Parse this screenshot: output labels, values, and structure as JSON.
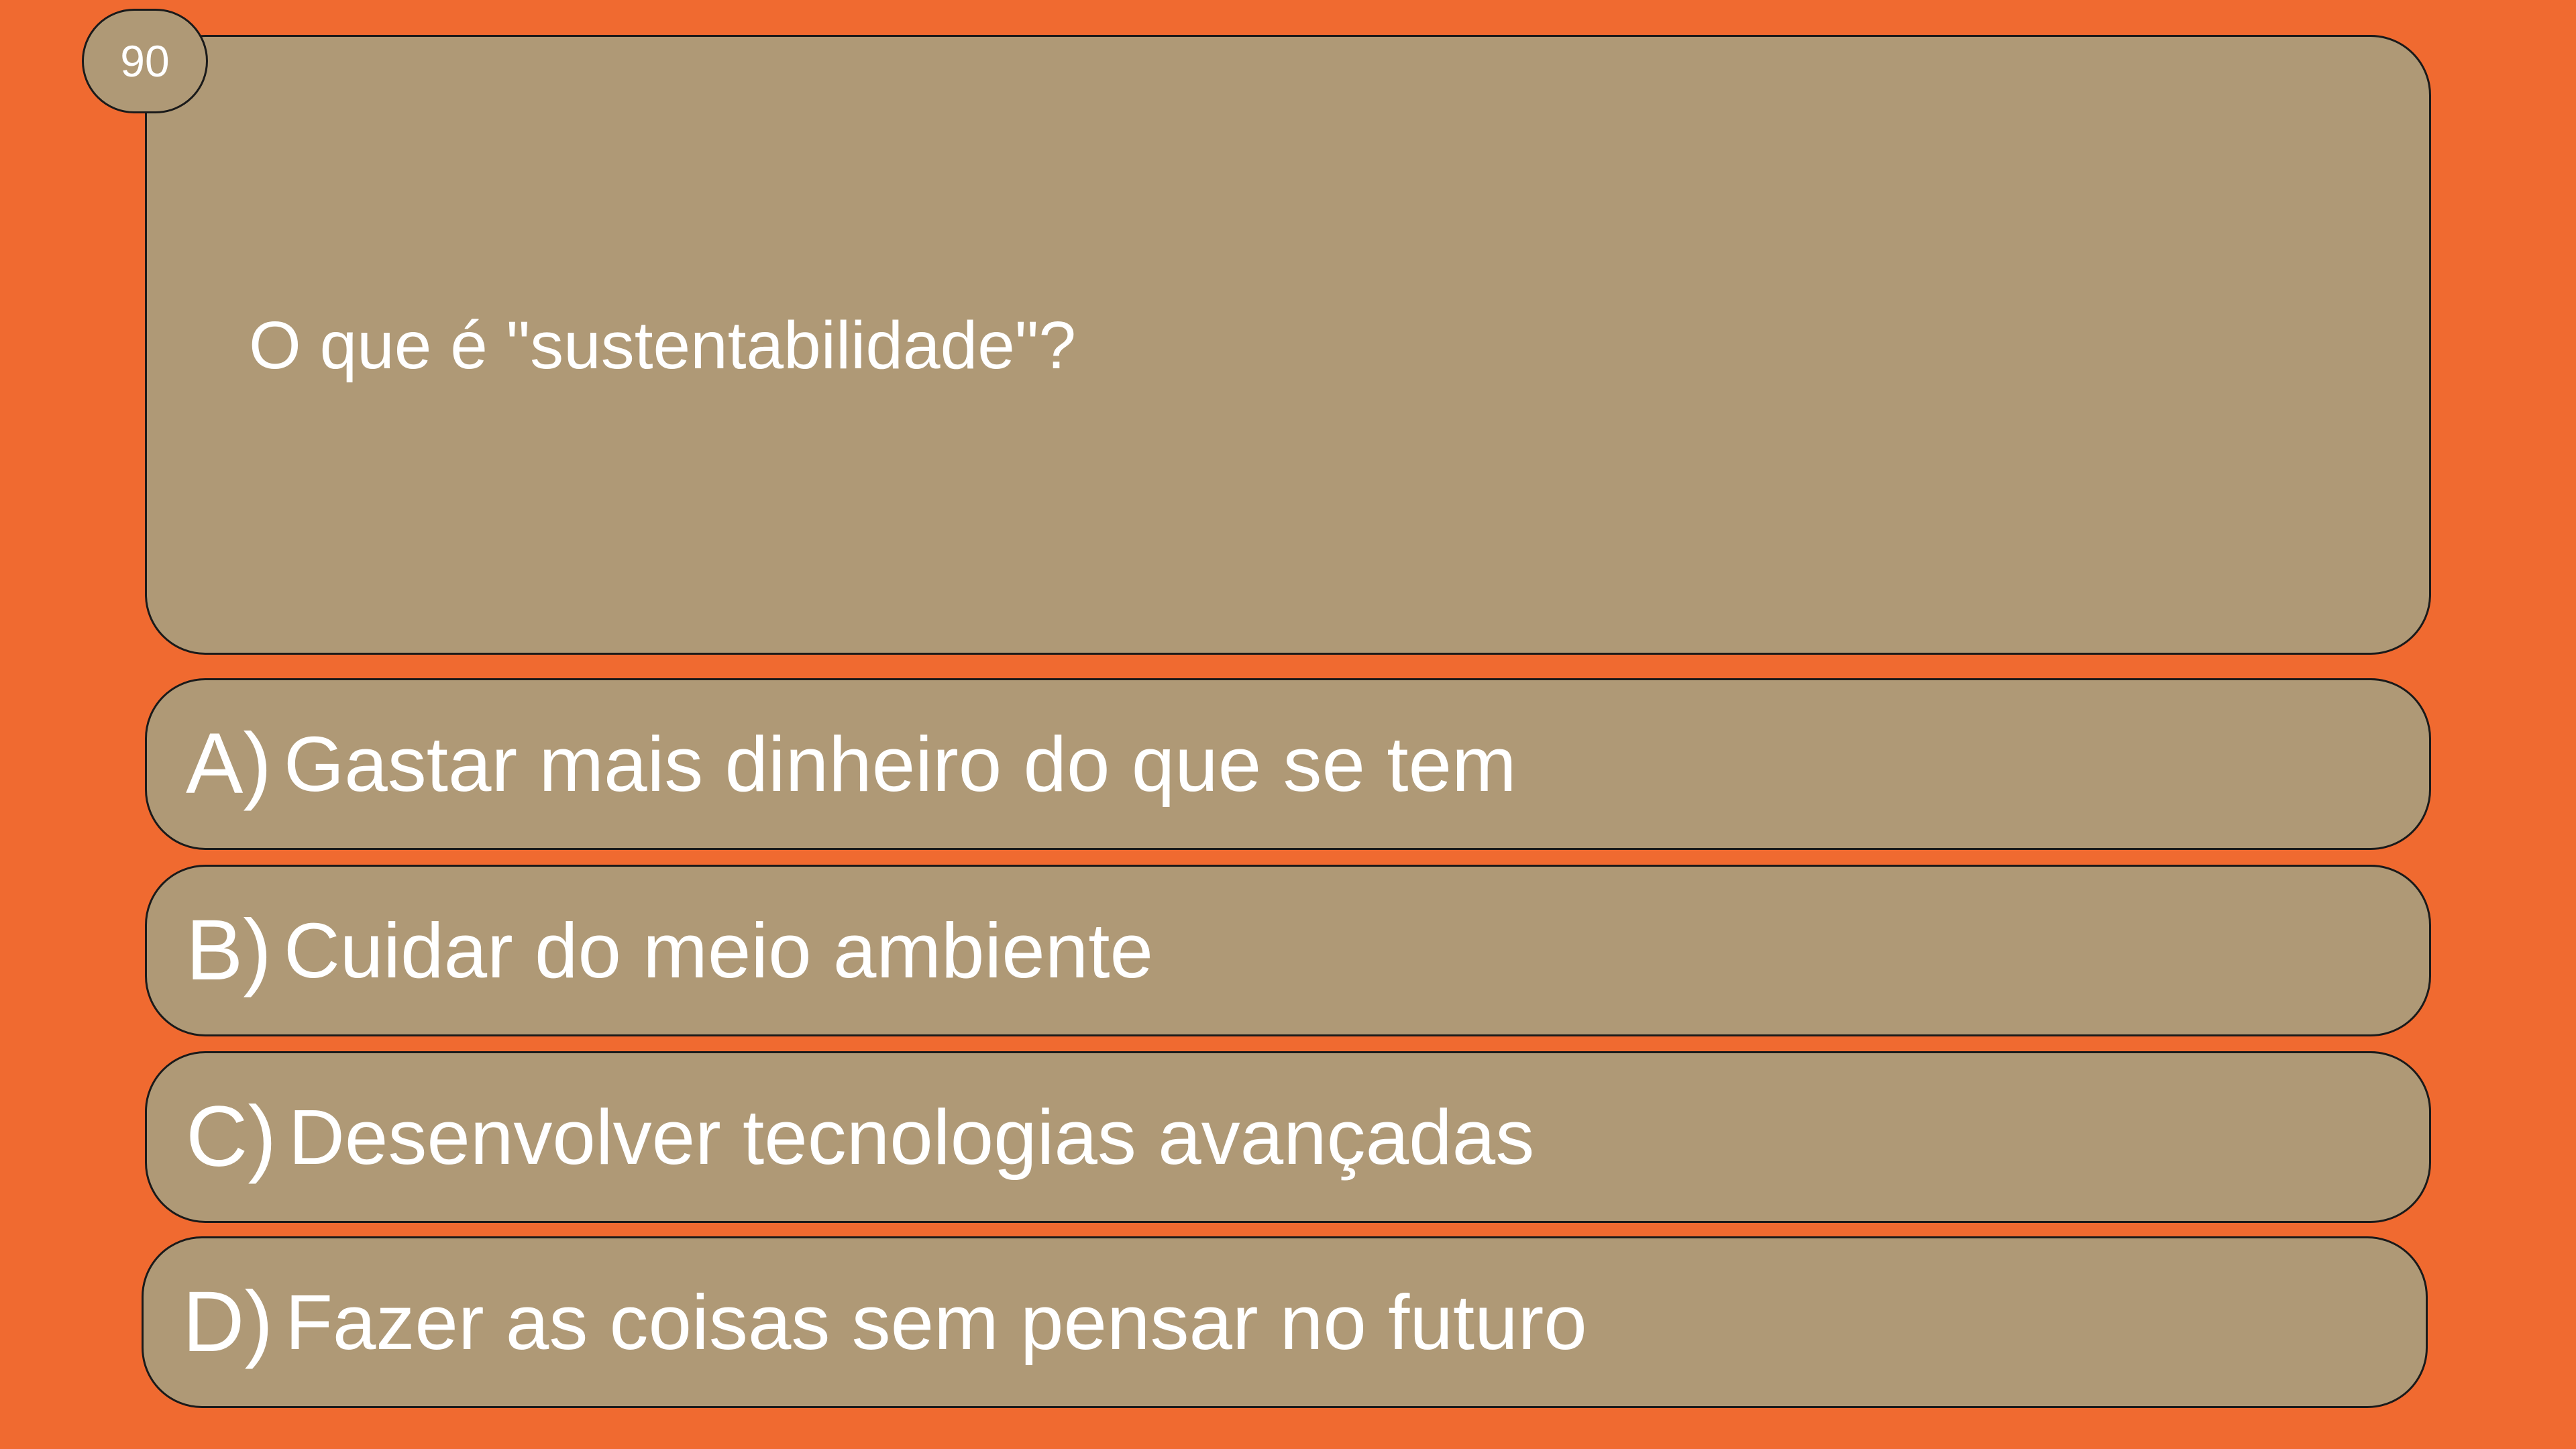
{
  "quiz": {
    "counter": "90",
    "question": "O que é \"sustentabilidade\"?",
    "options": [
      {
        "letter": "A)",
        "text": "Gastar mais dinheiro do que se tem"
      },
      {
        "letter": "B)",
        "text": "Cuidar do meio ambiente"
      },
      {
        "letter": "C)",
        "text": "Desenvolver tecnologias avançadas"
      },
      {
        "letter": "D)",
        "text": "Fazer as coisas sem pensar no futuro"
      }
    ]
  },
  "colors": {
    "background": "#f06a30",
    "card": "#af9976",
    "border": "#1a1a1a",
    "text": "#ffffff"
  }
}
